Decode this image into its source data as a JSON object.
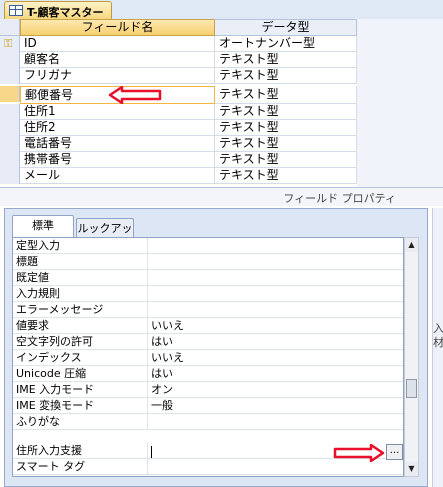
{
  "tab": {
    "title": "T-顧客マスター",
    "icon": "table-icon"
  },
  "grid": {
    "headers": {
      "field_name": "フィールド名",
      "data_type": "データ型"
    },
    "rows": [
      {
        "name": "ID",
        "type": "オートナンバー型",
        "primary_key": true
      },
      {
        "name": "顧客名",
        "type": "テキスト型"
      },
      {
        "name": "フリガナ",
        "type": "テキスト型"
      },
      {
        "name": "郵便番号",
        "type": "テキスト型",
        "selected": true
      },
      {
        "name": "住所1",
        "type": "テキスト型"
      },
      {
        "name": "住所2",
        "type": "テキスト型"
      },
      {
        "name": "電話番号",
        "type": "テキスト型"
      },
      {
        "name": "携帯番号",
        "type": "テキスト型"
      },
      {
        "name": "メール",
        "type": "テキスト型"
      }
    ]
  },
  "field_properties_label": "フィールド プロパティ",
  "property_tabs": {
    "standard": "標準",
    "lookup": "ルックアップ"
  },
  "properties": [
    {
      "name": "定型入力",
      "value": ""
    },
    {
      "name": "標題",
      "value": ""
    },
    {
      "name": "既定値",
      "value": ""
    },
    {
      "name": "入力規則",
      "value": ""
    },
    {
      "name": "エラーメッセージ",
      "value": ""
    },
    {
      "name": "値要求",
      "value": "いいえ"
    },
    {
      "name": "空文字列の許可",
      "value": "はい"
    },
    {
      "name": "インデックス",
      "value": "いいえ"
    },
    {
      "name": "Unicode 圧縮",
      "value": "はい"
    },
    {
      "name": "IME 入力モード",
      "value": "オン"
    },
    {
      "name": "IME 変換モード",
      "value": "一般"
    },
    {
      "name": "ふりがな",
      "value": ""
    },
    {
      "name": "住所入力支援",
      "value": ""
    },
    {
      "name": "スマート タグ",
      "value": ""
    }
  ],
  "builder_button": "...",
  "gutter_text": "入\n材",
  "colors": {
    "arrow_red": "#e8102a",
    "selection_border": "#f4b63e",
    "header_gold": "#f7cf70"
  }
}
